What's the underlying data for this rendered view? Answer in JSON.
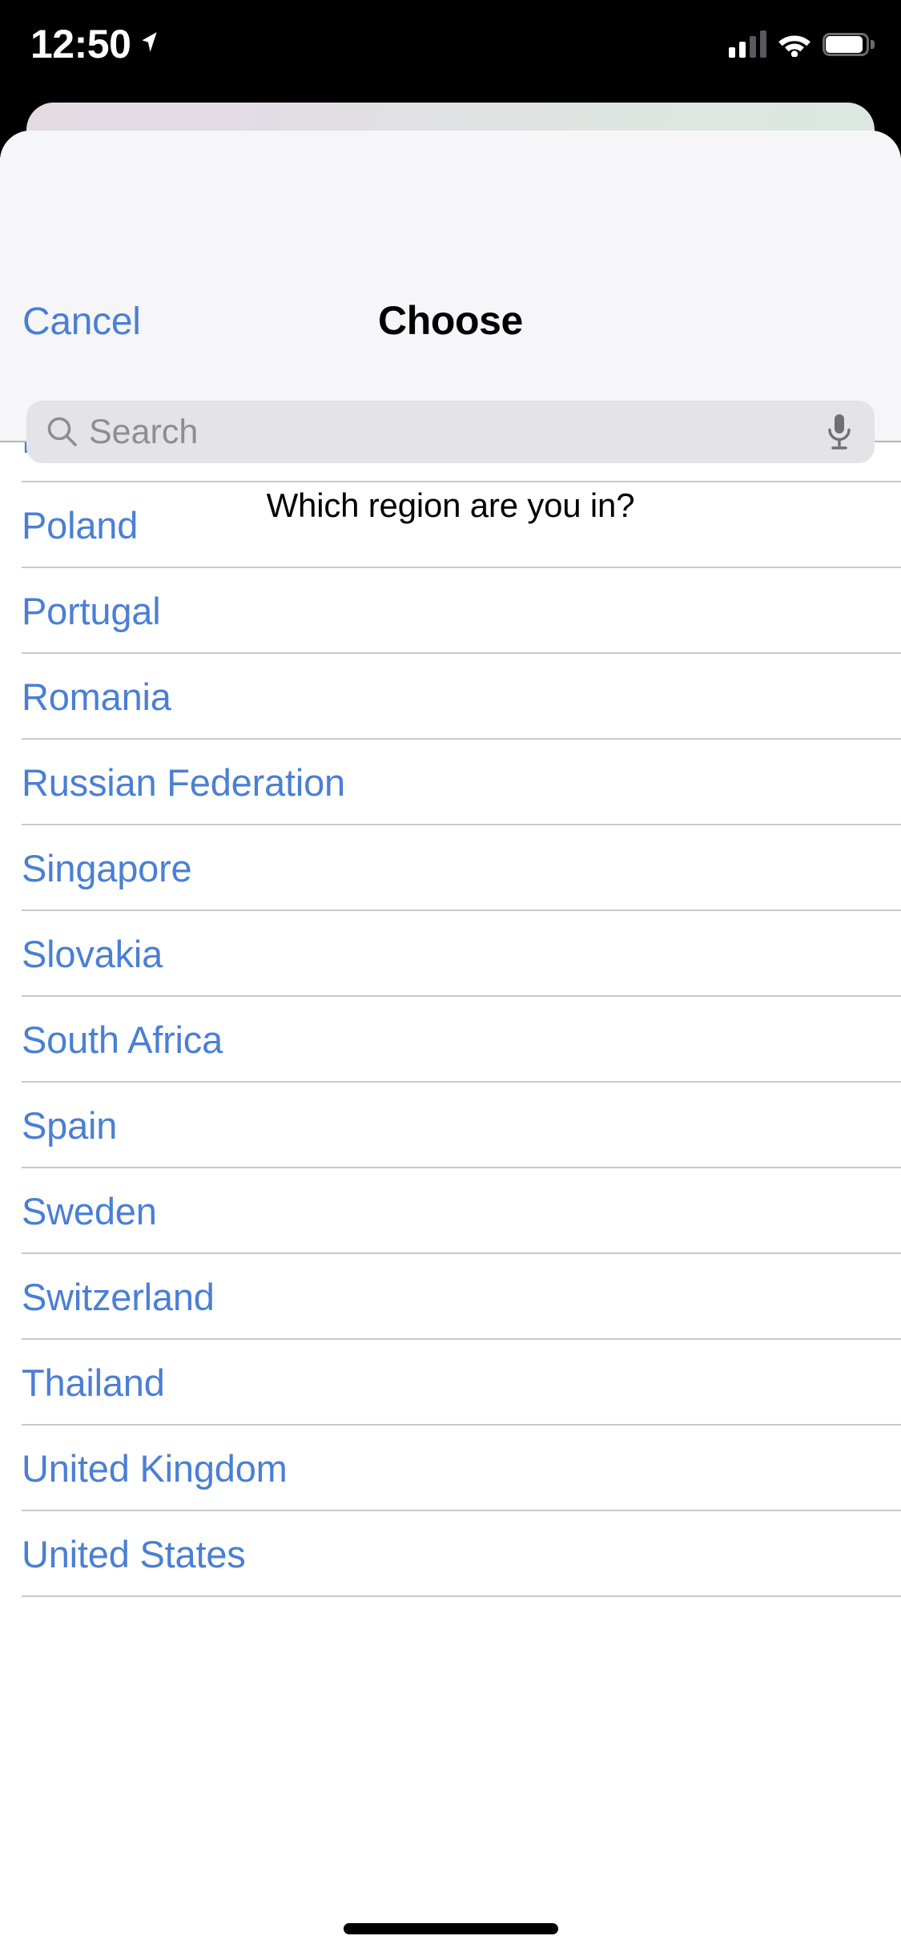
{
  "status_bar": {
    "time": "12:50",
    "location_icon": "location-arrow-icon",
    "signal_icon": "cellular-signal-icon",
    "signal_bars_filled": 2,
    "signal_bars_total": 4,
    "wifi_icon": "wifi-icon",
    "battery_icon": "battery-icon",
    "battery_level_percent": 85
  },
  "sheet": {
    "cancel_label": "Cancel",
    "title": "Choose",
    "prompt": "Which region are you in?"
  },
  "search": {
    "placeholder": "Search",
    "value": "",
    "search_icon": "search-icon",
    "mic_icon": "microphone-icon"
  },
  "region_list": {
    "items": [
      {
        "label": "Norway",
        "partially_hidden": true
      },
      {
        "label": "Poland"
      },
      {
        "label": "Portugal"
      },
      {
        "label": "Romania"
      },
      {
        "label": "Russian Federation"
      },
      {
        "label": "Singapore"
      },
      {
        "label": "Slovakia"
      },
      {
        "label": "South Africa"
      },
      {
        "label": "Spain"
      },
      {
        "label": "Sweden"
      },
      {
        "label": "Switzerland"
      },
      {
        "label": "Thailand"
      },
      {
        "label": "United Kingdom"
      },
      {
        "label": "United States"
      }
    ]
  },
  "colors": {
    "accent_blue": "#4a7fd4",
    "header_background": "#f6f6f8",
    "search_field_background": "#e4e4e8",
    "separator": "#c9c9cc",
    "sheet_background": "#ffffff",
    "status_bar_background": "#000000"
  },
  "home_indicator": "home-indicator"
}
